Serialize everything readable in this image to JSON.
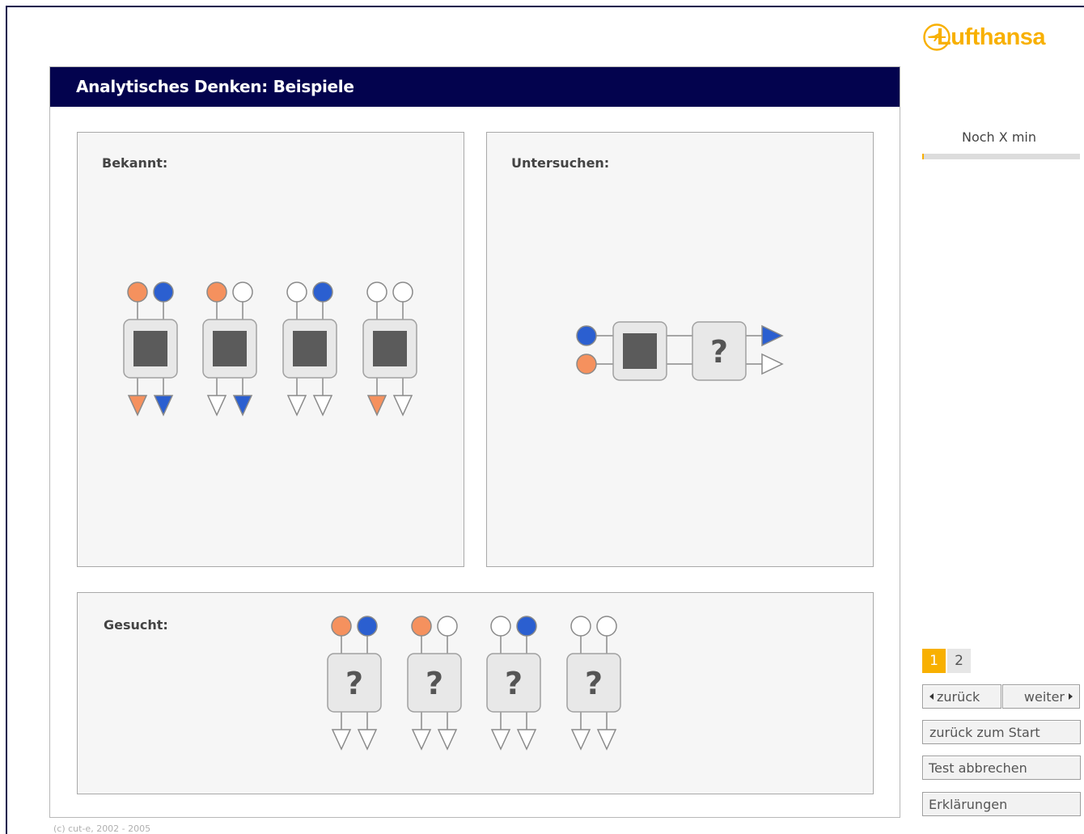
{
  "brand": {
    "name": "Lufthansa",
    "logo_icon": "crane-logo-icon",
    "color": "#f8b000"
  },
  "title": "Analytisches Denken: Beispiele",
  "panels": {
    "known": "Bekannt:",
    "investigate": "Untersuchen:",
    "sought": "Gesucht:"
  },
  "unknown_symbol": "?",
  "timer": {
    "label": "Noch X min",
    "progress": 0.01
  },
  "pagination": {
    "pages": [
      "1",
      "2"
    ],
    "current": "1"
  },
  "buttons": {
    "back": "zurück",
    "next": "weiter",
    "restart": "zurück zum Start",
    "cancel": "Test abbrechen",
    "help": "Erklärungen"
  },
  "copyright": "(c) cut-e, 2002 - 2005",
  "colors": {
    "orange": "#f5915e",
    "blue": "#2b5fd0",
    "navy": "#03034e",
    "box": "#5b5b5b"
  },
  "known_examples": [
    {
      "inputs": [
        "orange",
        "blue"
      ],
      "outputs": [
        "orange",
        "blue"
      ]
    },
    {
      "inputs": [
        "orange",
        "white"
      ],
      "outputs": [
        "white",
        "blue"
      ]
    },
    {
      "inputs": [
        "white",
        "blue"
      ],
      "outputs": [
        "white",
        "white"
      ]
    },
    {
      "inputs": [
        "white",
        "white"
      ],
      "outputs": [
        "orange",
        "white"
      ]
    }
  ],
  "investigate_example": {
    "inputs": [
      "blue",
      "orange"
    ],
    "outputs": [
      "blue",
      "white"
    ]
  },
  "sought_examples": [
    {
      "inputs": [
        "orange",
        "blue"
      ]
    },
    {
      "inputs": [
        "orange",
        "white"
      ]
    },
    {
      "inputs": [
        "white",
        "blue"
      ]
    },
    {
      "inputs": [
        "white",
        "white"
      ]
    }
  ]
}
